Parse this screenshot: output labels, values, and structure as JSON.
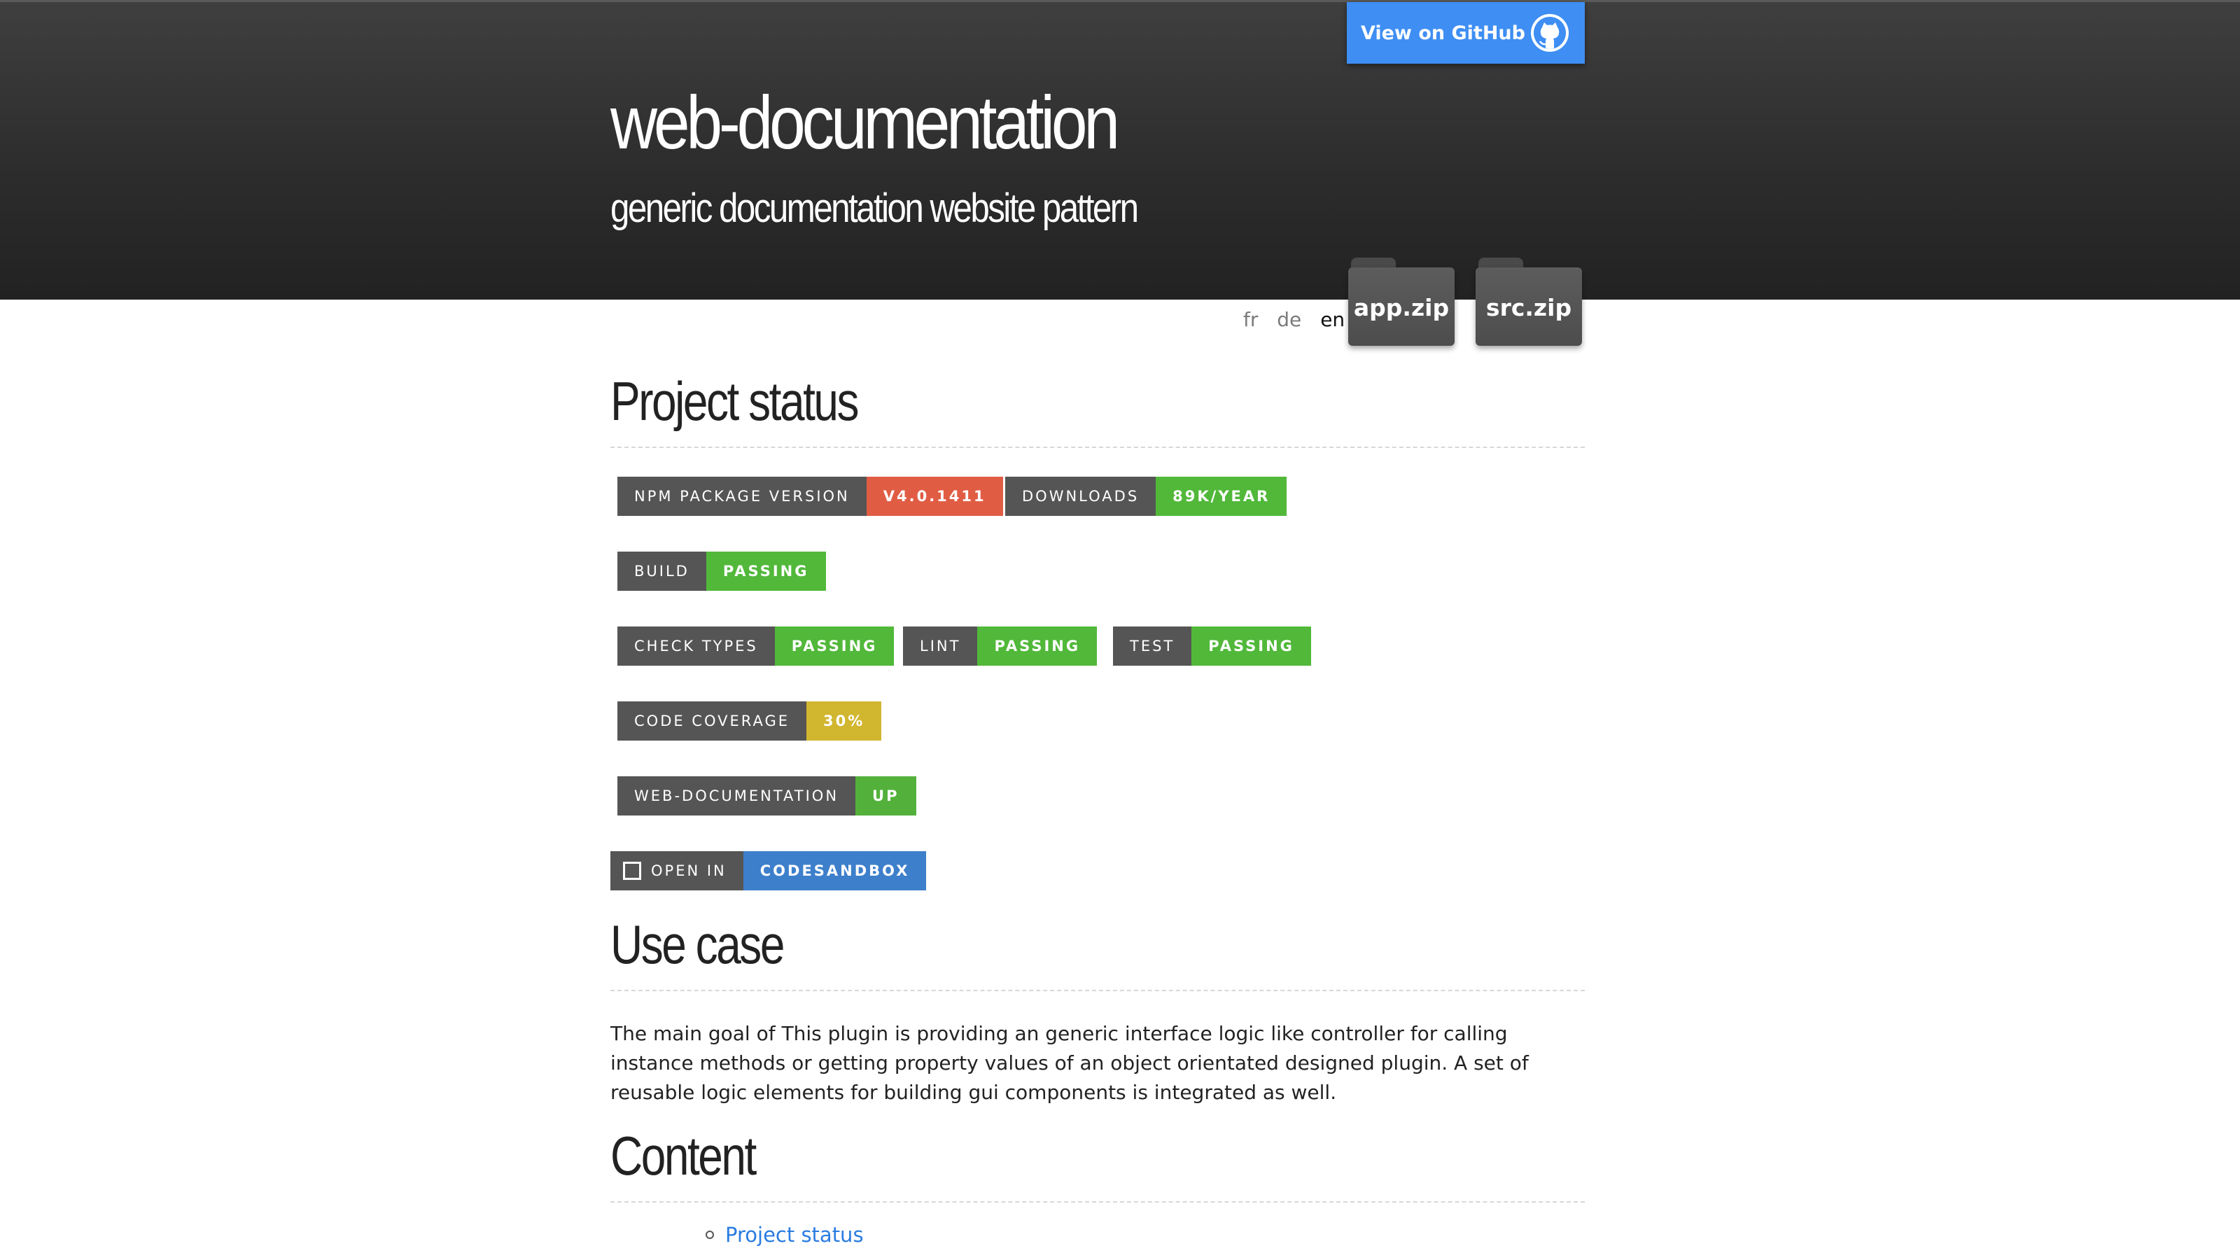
{
  "header": {
    "title": "web-documentation",
    "subtitle": "generic documentation website pattern",
    "github_button": {
      "label": "View on GitHub",
      "icon": "github-icon"
    }
  },
  "downloads": [
    {
      "label": "app.zip",
      "icon": "folder-icon"
    },
    {
      "label": "src.zip",
      "icon": "folder-icon"
    }
  ],
  "languages": [
    {
      "code": "fr",
      "active": false
    },
    {
      "code": "de",
      "active": false
    },
    {
      "code": "en",
      "active": true
    }
  ],
  "sections": {
    "project_status": {
      "heading": "Project status",
      "badges": [
        {
          "label": "npm package version",
          "value": "v4.0.1411",
          "color": "#e05d44"
        },
        {
          "label": "downloads",
          "value": "89k/year",
          "color": "#51b83a"
        },
        {
          "label": "build",
          "value": "passing",
          "color": "#51b83a"
        },
        {
          "label": "check types",
          "value": "passing",
          "color": "#51b83a"
        },
        {
          "label": "lint",
          "value": "passing",
          "color": "#51b83a"
        },
        {
          "label": "test",
          "value": "passing",
          "color": "#51b83a"
        },
        {
          "label": "code coverage",
          "value": "30%",
          "color": "#d1b62f"
        },
        {
          "label": "web-documentation",
          "value": "up",
          "color": "#53b13b"
        },
        {
          "label": "Open in",
          "value": "CodeSandbox",
          "color": "#3d7fcb",
          "icon": "codesandbox-icon"
        }
      ]
    },
    "use_case": {
      "heading": "Use case",
      "text": "The main goal of This plugin is providing an generic interface logic like controller for calling instance methods or getting property values of an object orientated designed plugin. A set of reusable logic elements for building gui components is integrated as well."
    },
    "content": {
      "heading": "Content",
      "toc": [
        {
          "label": "Project status"
        }
      ]
    }
  }
}
